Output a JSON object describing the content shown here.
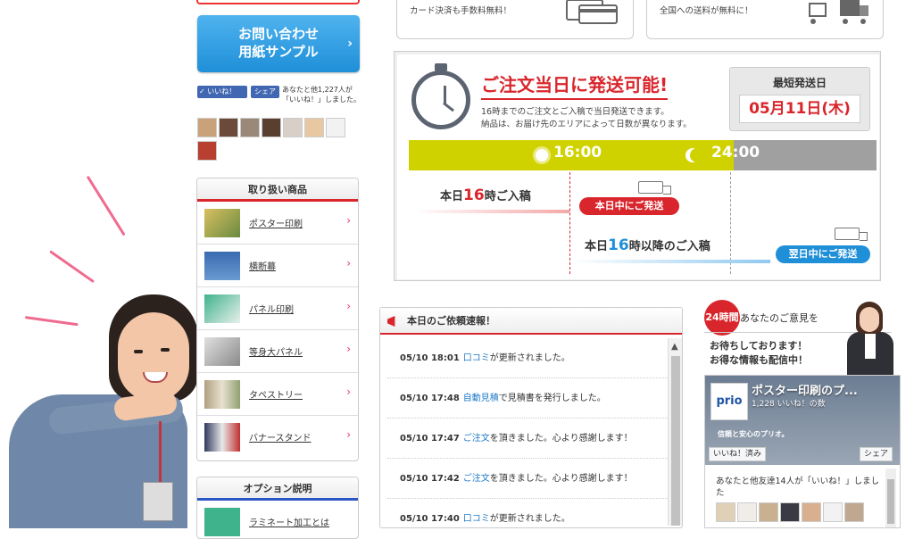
{
  "sidebar": {
    "sample_button": {
      "line1": "お問い合わせ",
      "line2": "用紙サンプル",
      "arrow": "›"
    },
    "facebook": {
      "like_label": "✓ いいね！",
      "share_label": "シェア",
      "count_text": "あなたと他1,227人が「いいね！」しました。"
    },
    "products": {
      "heading": "取り扱い商品",
      "items": [
        {
          "label": "ポスター印刷"
        },
        {
          "label": "横断幕"
        },
        {
          "label": "パネル印刷"
        },
        {
          "label": "等身大パネル"
        },
        {
          "label": "タペストリー"
        },
        {
          "label": "バナースタンド"
        }
      ]
    },
    "options": {
      "heading": "オプション説明",
      "first_item": "ラミネート加工とは"
    }
  },
  "top_cards": {
    "card1": "カード決済も手数料無料！",
    "card2": "全国への送料が無料に！"
  },
  "shipping": {
    "title": "ご注文当日に発送可能!",
    "desc_line1": "16時までのご注文とご入稿で当日発送できます。",
    "desc_line2": "納品は、お届け先のエリアによって日数が異なります。",
    "fastest_label": "最短発送日",
    "fastest_date": "05月11日(木)",
    "time_day": "16:00",
    "time_night": "24:00",
    "row1_pre": "本日",
    "row1_hour": "16",
    "row1_post": "時ご入稿",
    "row1_pill": "本日中にご発送",
    "row2_pre": "本日",
    "row2_hour": "16",
    "row2_post": "時以降のご入稿",
    "row2_pill": "翌日中にご発送"
  },
  "news": {
    "heading": "本日のご依頼速報！",
    "items": [
      {
        "time": "05/10 18:01",
        "link": "口コミ",
        "text": "が更新されました。"
      },
      {
        "time": "05/10 17:48",
        "link": "自動見積",
        "text": "で見積書を発行しました。"
      },
      {
        "time": "05/10 17:47",
        "link": "ご注文",
        "text": "を頂きました。心より感謝します！"
      },
      {
        "time": "05/10 17:42",
        "link": "ご注文",
        "text": "を頂きました。心より感謝します！"
      },
      {
        "time": "05/10 17:40",
        "link": "口コミ",
        "text": "が更新されました。"
      }
    ]
  },
  "opinion": {
    "badge": "24時間",
    "title": "あなたのご意見を",
    "line1": "お待ちしております！",
    "line2": "お得な情報も配信中！"
  },
  "fb_page": {
    "logo": "prio",
    "name": "ポスター印刷のプ...",
    "likes": "1,228 いいね！の数",
    "slogan": "信頼と安心のプリオ。",
    "liked_btn": "いいね！済み",
    "share_btn": "シェア",
    "friends_text": "あなたと他友達14人が「いいね！」しました"
  },
  "colors": {
    "accent_red": "#d9262c",
    "accent_blue": "#1f8fd8",
    "time_yellow": "#d0d200"
  }
}
